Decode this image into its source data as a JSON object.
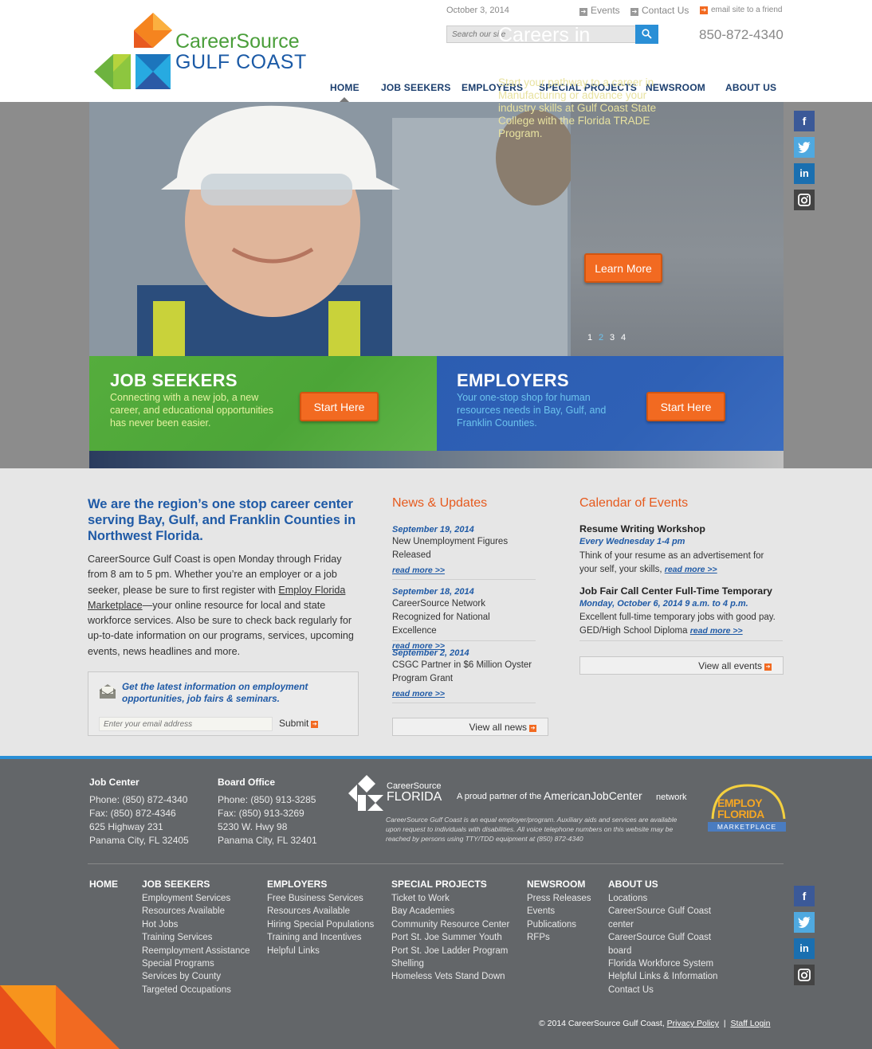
{
  "header": {
    "logo_line1": "CareerSource",
    "logo_line2": "GULF COAST",
    "date": "October 3, 2014",
    "events_link": "Events",
    "contact_link": "Contact Us",
    "email_link": "email site to a friend",
    "search_placeholder": "Search our site",
    "phone": "850-872-4340",
    "nav": [
      "HOME",
      "JOB SEEKERS",
      "EMPLOYERS",
      "SPECIAL PROJECTS",
      "NEWSROOM",
      "ABOUT US"
    ]
  },
  "hero": {
    "title": "Careers in Manufacturing",
    "text": "Start your pathway to a career in Manufacturing or advance your industry skills at Gulf Coast State College with the Florida TRADE Program.",
    "button": "Learn More",
    "pager": [
      "1",
      "2",
      "3",
      "4"
    ],
    "active_page": "2"
  },
  "tiles": {
    "jobseekers": {
      "title": "JOB SEEKERS",
      "text": "Connecting with a new job, a new career, and educational opportunities has never been easier.",
      "button": "Start Here"
    },
    "employers": {
      "title": "EMPLOYERS",
      "text": "Your one-stop shop for human resources needs in Bay, Gulf, and Franklin Counties.",
      "button": "Start Here"
    }
  },
  "intro": {
    "title": "We are the region’s one stop career center serving Bay, Gulf, and Franklin Counties in Northwest Florida.",
    "text_before": "CareerSource Gulf Coast is open Monday through Friday from 8 am to 5 pm. Whether you’re an employer or a job seeker, please be sure to first register with ",
    "link": "Employ Florida Marketplace",
    "text_after": "—your online resource for local and state workforce services. Also be sure to check back regularly for up-to-date information on our programs, services, upcoming events, news headlines and more."
  },
  "signup": {
    "text": "Get the latest information on employment opportunities, job fairs & seminars.",
    "placeholder": "Enter your email address",
    "submit": "Submit"
  },
  "news": {
    "title": "News & Updates",
    "items": [
      {
        "date": "September 19, 2014",
        "text": "New Unemployment Figures Released",
        "more": "read more >>"
      },
      {
        "date": "September 18, 2014",
        "text": "CareerSource Network Recognized for National Excellence",
        "more": "read more >>"
      },
      {
        "date": "September 2, 2014",
        "text": "CSGC Partner in $6 Million Oyster Program Grant",
        "more": "read more >>"
      }
    ],
    "view_all": "View all news"
  },
  "events": {
    "title": "Calendar of Events",
    "items": [
      {
        "title": "Resume Writing Workshop",
        "when": "Every Wednesday 1-4 pm",
        "text": "Think of your resume as an advertisement for your self, your skills,",
        "more": "read more >>"
      },
      {
        "title": "Job Fair Call Center Full-Time Temporary",
        "when": "Monday, October 6, 2014 9 a.m. to 4 p.m.",
        "text": "Excellent full-time temporary jobs with good pay. GED/High School Diploma",
        "more": "read more >>"
      }
    ],
    "view_all": "View all events"
  },
  "footer": {
    "job_center": {
      "head": "Job Center",
      "lines": [
        "Phone: (850) 872-4340",
        "Fax: (850) 872-4346",
        "625 Highway 231",
        "Panama City, FL 32405"
      ]
    },
    "board_office": {
      "head": "Board Office",
      "lines": [
        "Phone: (850) 913-3285",
        "Fax: (850) 913-3269",
        "5230 W. Hwy 98",
        "Panama City, FL 32401"
      ]
    },
    "cs_florida_line1": "CareerSource",
    "cs_florida_line2": "FLORIDA",
    "partner": "A proud partner of the",
    "ajc": "AmericanJobCenter",
    "network": "network",
    "eeo": "CareerSource Gulf Coast is an equal employer/program. Auxiliary aids and services are available upon request to individuals with disabilities. All voice telephone numbers on this website may be reached by persons using TTY/TDD equipment at (850) 872-4340",
    "efm_line1": "EMPLOY",
    "efm_line2": "FLORIDA",
    "efm_line3": "MARKETPLACE",
    "columns": [
      {
        "head": "HOME",
        "links": []
      },
      {
        "head": "JOB SEEKERS",
        "links": [
          "Employment Services",
          "Resources Available",
          "Hot Jobs",
          "Training Services",
          "Reemployment Assistance",
          "Special Programs",
          "Services by County",
          "Targeted Occupations"
        ]
      },
      {
        "head": "EMPLOYERS",
        "links": [
          "Free Business Services",
          "Resources Available",
          "Hiring Special Populations",
          "Training and Incentives",
          "Helpful Links"
        ]
      },
      {
        "head": "SPECIAL PROJECTS",
        "links": [
          "Ticket to Work",
          "Bay Academies",
          "Community Resource Center",
          "Port St. Joe Summer Youth",
          "Port St. Joe Ladder Program",
          "Shelling",
          "Homeless Vets Stand Down"
        ]
      },
      {
        "head": "NEWSROOM",
        "links": [
          "Press Releases",
          "Events",
          "Publications",
          "RFPs"
        ]
      },
      {
        "head": "ABOUT US",
        "links": [
          "Locations",
          "CareerSource Gulf Coast center",
          "CareerSource Gulf Coast board",
          "Florida Workforce System",
          "Helpful Links & Information",
          "Contact Us"
        ]
      }
    ],
    "copyright": "© 2014 CareerSource Gulf Coast,",
    "privacy": "Privacy Policy",
    "separator": "|",
    "staff_login": "Staff Login"
  },
  "colors": {
    "brand_blue": "#1f5aa6",
    "brand_orange": "#f26a21",
    "brand_green": "#4ca537",
    "nav_navy": "#1b3e6e",
    "footer_gray": "#636669"
  }
}
